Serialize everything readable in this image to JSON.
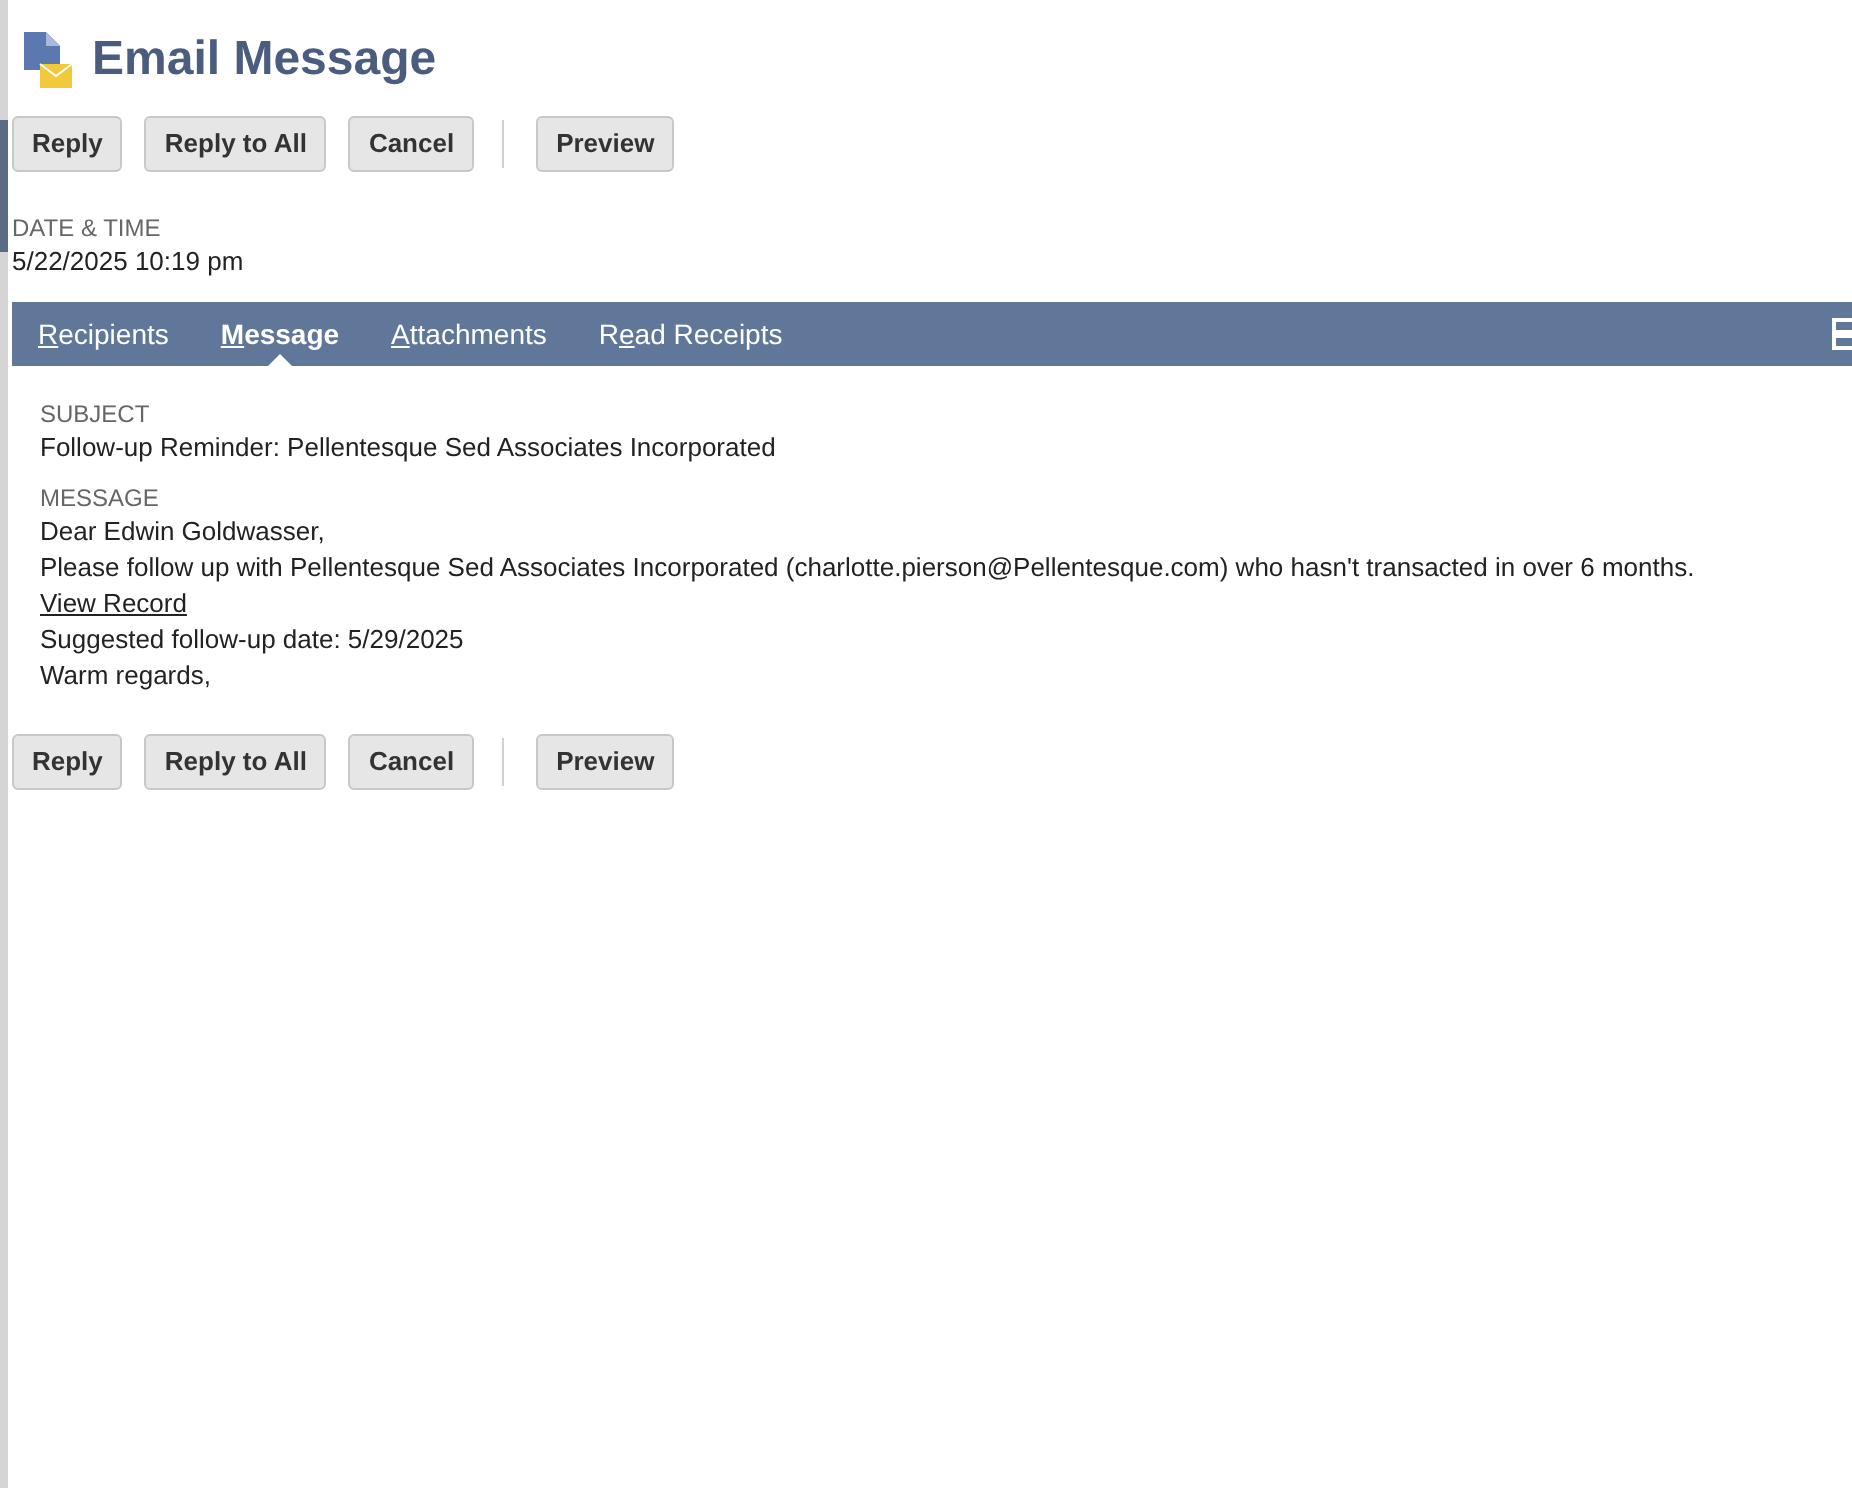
{
  "title": "Email Message",
  "top_buttons": [
    "Reply",
    "Reply to All",
    "Cancel",
    "Preview"
  ],
  "date_time": {
    "label": "DATE & TIME",
    "value": "5/22/2025 10:19 pm"
  },
  "tabs": [
    {
      "key": "R",
      "after": "ecipients",
      "selected": false
    },
    {
      "key": "M",
      "after": "essage",
      "selected": true
    },
    {
      "key": "A",
      "after": "ttachments",
      "selected": false
    },
    {
      "before": "R",
      "key": "e",
      "after": "ad Receipts",
      "selected": false
    }
  ],
  "subject": {
    "label": "SUBJECT",
    "value": "Follow-up Reminder: Pellentesque Sed Associates Incorporated"
  },
  "message": {
    "label": "MESSAGE",
    "lines": [
      {
        "kind": "text",
        "text": "Dear Edwin Goldwasser,"
      },
      {
        "kind": "text",
        "text": "Please follow up with Pellentesque Sed Associates Incorporated (charlotte.pierson@Pellentesque.com) who hasn't transacted in over 6 months."
      },
      {
        "kind": "link",
        "text": "View Record"
      },
      {
        "kind": "text",
        "text": "Suggested follow-up date: 5/29/2025"
      },
      {
        "kind": "text",
        "text": "Warm regards,"
      }
    ]
  },
  "bottom_buttons": [
    "Reply",
    "Reply to All",
    "Cancel",
    "Preview"
  ]
}
